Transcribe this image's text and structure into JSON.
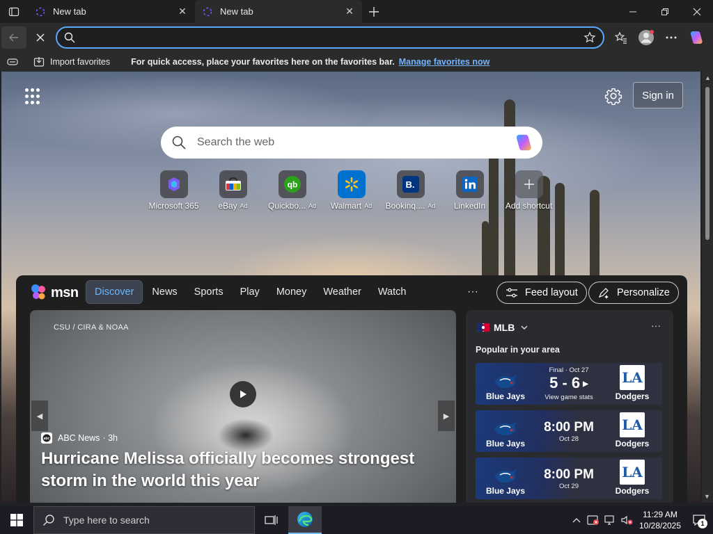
{
  "browser": {
    "tabs": [
      {
        "title": "New tab",
        "active": false
      },
      {
        "title": "New tab",
        "active": true
      }
    ],
    "address_bar": {
      "value": "",
      "placeholder": ""
    },
    "favorites_bar": {
      "import_label": "Import favorites",
      "message": "For quick access, place your favorites here on the favorites bar.",
      "manage_link": "Manage favorites now"
    }
  },
  "newtab": {
    "signin_label": "Sign in",
    "search_placeholder": "Search the web",
    "shortcuts": [
      {
        "label": "Microsoft 365",
        "ad": "",
        "icon": "microsoft365-icon"
      },
      {
        "label": "eBay",
        "ad": "Ad",
        "icon": "ebay-icon"
      },
      {
        "label": "Quickbo...",
        "ad": "Ad",
        "icon": "quickbooks-icon"
      },
      {
        "label": "Walmart",
        "ad": "Ad",
        "icon": "walmart-icon"
      },
      {
        "label": "Bookinq....",
        "ad": "Ad",
        "icon": "booking-icon"
      },
      {
        "label": "LinkedIn",
        "ad": "",
        "icon": "linkedin-icon"
      },
      {
        "label": "Add shortcut",
        "ad": "",
        "icon": "plus-icon"
      }
    ]
  },
  "feed": {
    "logo_text": "msn",
    "nav": [
      "Discover",
      "News",
      "Sports",
      "Play",
      "Money",
      "Weather",
      "Watch"
    ],
    "more": "···",
    "feed_layout_label": "Feed layout",
    "personalize_label": "Personalize",
    "hero": {
      "credit": "CSU / CIRA & NOAA",
      "source": "ABC News",
      "age": "· 3h",
      "headline": "Hurricane Melissa officially becomes strongest storm in the world this year"
    },
    "mlb": {
      "title": "MLB",
      "subtitle": "Popular in your area",
      "more": "···",
      "games": [
        {
          "home": "Blue Jays",
          "away": "Dodgers",
          "status": "Final · Oct 27",
          "main": "5 - 6",
          "sub": "View game stats",
          "final": true
        },
        {
          "home": "Blue Jays",
          "away": "Dodgers",
          "status": "",
          "main": "8:00 PM",
          "sub": "Oct 28",
          "final": false
        },
        {
          "home": "Blue Jays",
          "away": "Dodgers",
          "status": "",
          "main": "8:00 PM",
          "sub": "Oct 29",
          "final": false
        }
      ]
    }
  },
  "taskbar": {
    "search_placeholder": "Type here to search",
    "time": "11:29 AM",
    "date": "10/28/2025",
    "notification_count": "1"
  },
  "colors": {
    "accent": "#5aa7ff",
    "link": "#74b3ff",
    "dodgers_blue": "#1e5aa8"
  }
}
